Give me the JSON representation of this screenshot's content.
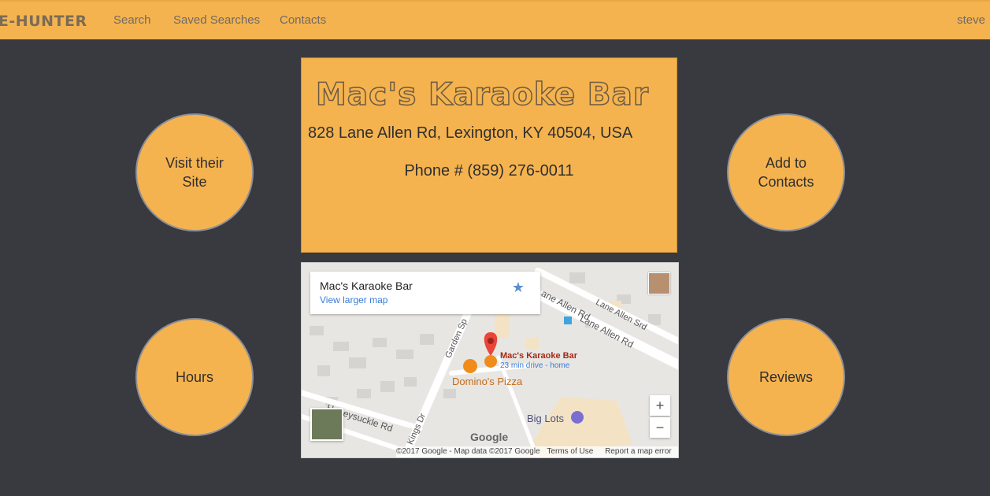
{
  "nav": {
    "brand": "UE-HUNTER",
    "links": [
      "Search",
      "Saved Searches",
      "Contacts"
    ],
    "user": "steve"
  },
  "circles": {
    "visit_site": "Visit their Site",
    "add_contacts": "Add to Contacts",
    "hours": "Hours",
    "reviews": "Reviews"
  },
  "venue": {
    "name": "Mac's Karaoke Bar",
    "address": "828 Lane Allen Rd, Lexington, KY 40504, USA",
    "phone": "Phone # (859) 276-0011"
  },
  "map": {
    "card_title": "Mac's Karaoke Bar",
    "card_link": "View larger map",
    "pin_label": "Mac's Karaoke Bar",
    "pin_sub": "23 min drive - home",
    "poi_dominos": "Domino's Pizza",
    "poi_biglots": "Big Lots",
    "street_1": "Lane Allen Rd",
    "street_2": "Lane Allen Srd",
    "street_3": "Honeysuckle Rd",
    "street_4": "Garden Sp",
    "street_5": "Kings Dr",
    "google": "Google",
    "footer_copyright": "©2017 Google - Map data ©2017 Google",
    "footer_terms": "Terms of Use",
    "footer_report": "Report a map error",
    "zoom_in": "+",
    "zoom_out": "−",
    "star": "★"
  },
  "colors": {
    "accent": "#f5b34f",
    "background": "#393a40",
    "pin_red": "#e8463a",
    "link_blue": "#3a7bd5"
  }
}
